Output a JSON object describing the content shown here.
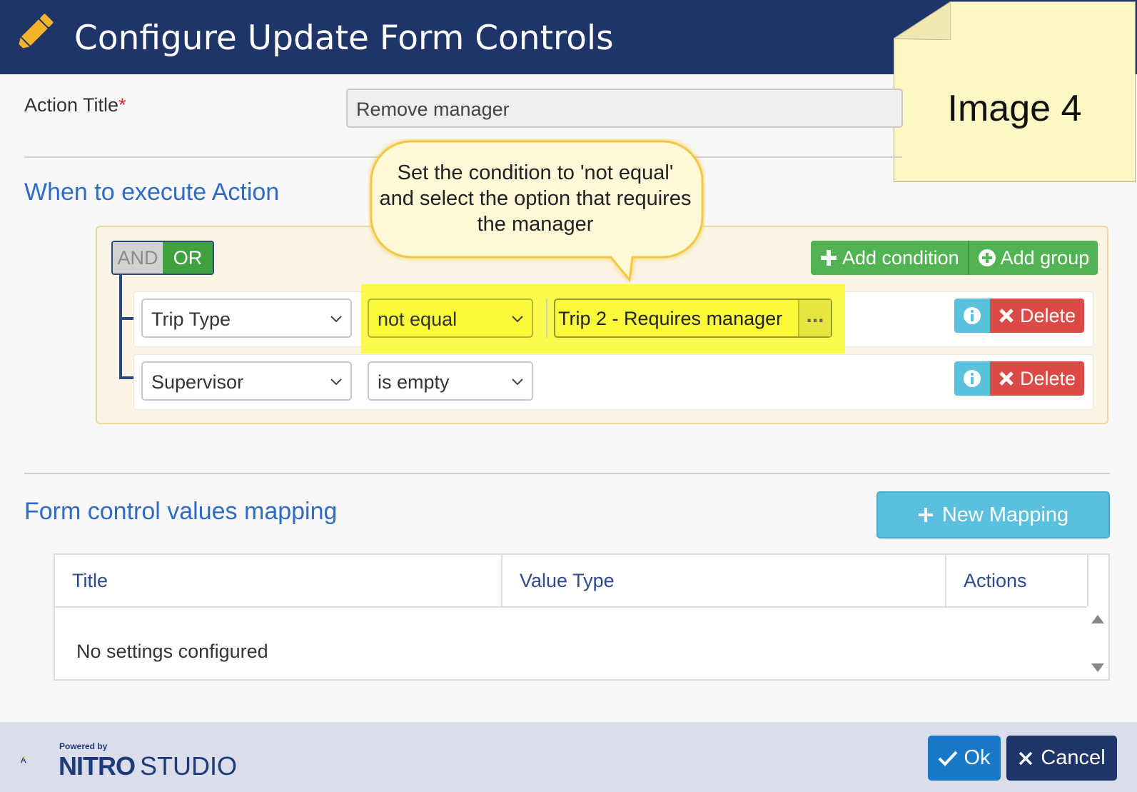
{
  "dialog": {
    "title": "Configure Update Form Controls"
  },
  "sticky_note": {
    "text": "Image 4"
  },
  "action_title": {
    "label": "Action Title",
    "required_mark": "*",
    "value": "Remove manager"
  },
  "when_section": {
    "title": "When to execute Action",
    "and_label": "AND",
    "or_label": "OR",
    "active_logic": "OR",
    "add_condition_label": "Add condition",
    "add_group_label": "Add group",
    "rules": [
      {
        "field": "Trip Type",
        "operator": "not equal",
        "value": "Trip 2 - Requires manager",
        "value_button": "...",
        "delete_label": "Delete"
      },
      {
        "field": "Supervisor",
        "operator": "is empty",
        "delete_label": "Delete"
      }
    ]
  },
  "callout": {
    "text": "Set the condition to 'not equal' and select the option that requires the manager"
  },
  "mapping_section": {
    "title": "Form control values mapping",
    "new_mapping_label": "New Mapping",
    "columns": [
      "Title",
      "Value Type",
      "Actions"
    ],
    "empty_message": "No settings configured"
  },
  "footer": {
    "powered_by": "Powered by",
    "brand_bold": "NITRO",
    "brand_light": "STUDIO",
    "ok_label": "Ok",
    "cancel_label": "Cancel"
  },
  "colors": {
    "header_bg": "#1f3468",
    "accent_blue": "#2e6bc6",
    "success_green": "#52b352",
    "danger_red": "#dc4a48",
    "info_blue": "#5bc0de",
    "highlight_yellow": "#fafa2c"
  }
}
